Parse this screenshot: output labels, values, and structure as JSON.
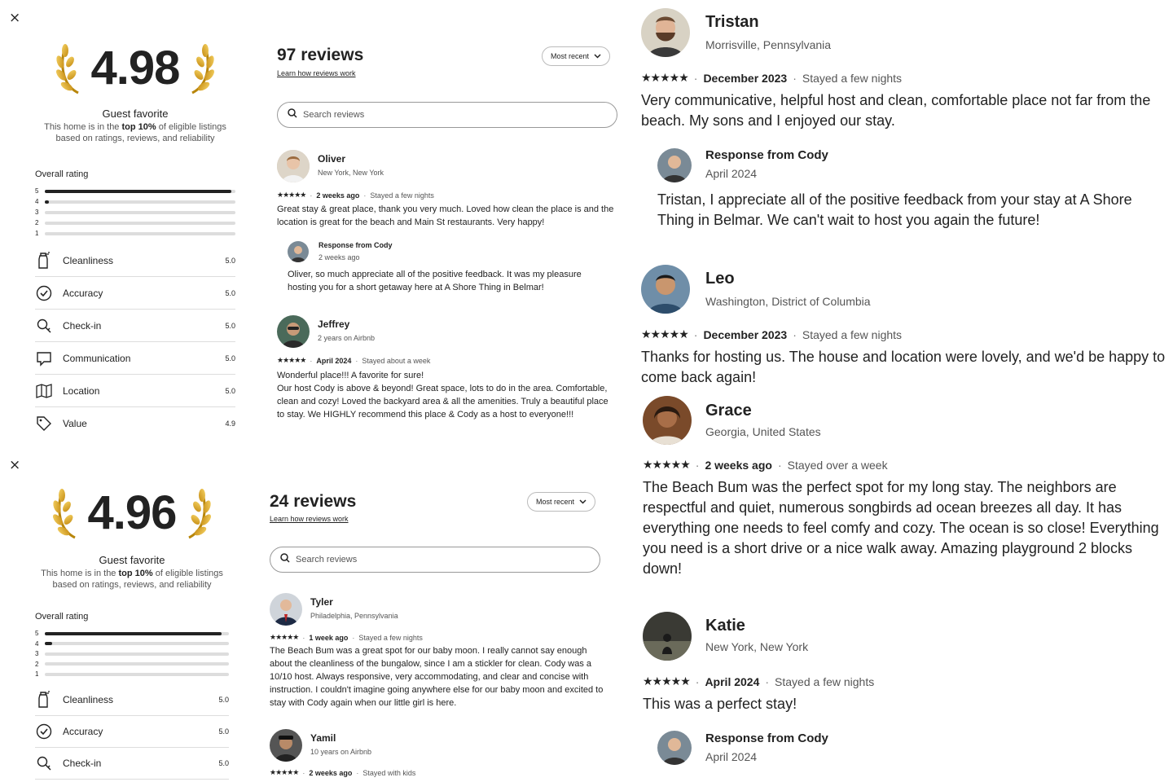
{
  "panels": [
    {
      "close_icon": "×",
      "rating": "4.98",
      "guest_favorite": "Guest favorite",
      "desc_pre": "This home is in the ",
      "desc_bold": "top 10%",
      "desc_post": " of eligible listings based on ratings, reviews, and reliability",
      "overall_label": "Overall rating",
      "histogram": [
        {
          "star": "5",
          "fraction": 0.98
        },
        {
          "star": "4",
          "fraction": 0.02
        },
        {
          "star": "3",
          "fraction": 0
        },
        {
          "star": "2",
          "fraction": 0
        },
        {
          "star": "1",
          "fraction": 0
        }
      ],
      "categories": [
        {
          "label": "Cleanliness",
          "score": "5.0",
          "icon": "spray-bottle-icon"
        },
        {
          "label": "Accuracy",
          "score": "5.0",
          "icon": "check-circle-icon"
        },
        {
          "label": "Check-in",
          "score": "5.0",
          "icon": "key-icon"
        },
        {
          "label": "Communication",
          "score": "5.0",
          "icon": "message-icon"
        },
        {
          "label": "Location",
          "score": "5.0",
          "icon": "map-icon"
        },
        {
          "label": "Value",
          "score": "4.9",
          "icon": "tag-icon"
        }
      ],
      "reviews_title": "97 reviews",
      "learn_link": "Learn how reviews work",
      "sort_label": "Most recent",
      "search_placeholder": "Search reviews",
      "reviews": [
        {
          "name": "Oliver",
          "location": "New York, New York",
          "stars": "★★★★★",
          "date": "2 weeks ago",
          "stay": "Stayed a few nights",
          "text": "Great stay & great place, thank you very much. Loved how clean the place is and the location is great for the beach and Main St restaurants. Very happy!",
          "response": {
            "title": "Response from Cody",
            "date": "2 weeks ago",
            "text": "Oliver, so much appreciate all of the positive feedback. It was my pleasure hosting you for a short getaway here at A Shore Thing in Belmar!"
          }
        },
        {
          "name": "Jeffrey",
          "location": "2 years on Airbnb",
          "stars": "★★★★★",
          "date": "April 2024",
          "stay": "Stayed about a week",
          "text": "Wonderful place!!! A favorite for sure!\nOur host Cody is above & beyond! Great space, lots to do in the area. Comfortable, clean and cozy! Loved the backyard area & all the amenities. Truly a beautiful place to stay. We HIGHLY recommend this place & Cody as a host to everyone!!!"
        }
      ]
    },
    {
      "close_icon": "×",
      "rating": "4.96",
      "guest_favorite": "Guest favorite",
      "desc_pre": "This home is in the ",
      "desc_bold": "top 10%",
      "desc_post": " of eligible listings based on ratings, reviews, and reliability",
      "overall_label": "Overall rating",
      "histogram": [
        {
          "star": "5",
          "fraction": 0.96
        },
        {
          "star": "4",
          "fraction": 0.04
        },
        {
          "star": "3",
          "fraction": 0
        },
        {
          "star": "2",
          "fraction": 0
        },
        {
          "star": "1",
          "fraction": 0
        }
      ],
      "categories": [
        {
          "label": "Cleanliness",
          "score": "5.0",
          "icon": "spray-bottle-icon"
        },
        {
          "label": "Accuracy",
          "score": "5.0",
          "icon": "check-circle-icon"
        },
        {
          "label": "Check-in",
          "score": "5.0",
          "icon": "key-icon"
        }
      ],
      "reviews_title": "24 reviews",
      "learn_link": "Learn how reviews work",
      "sort_label": "Most recent",
      "search_placeholder": "Search reviews",
      "reviews": [
        {
          "name": "Tyler",
          "location": "Philadelphia, Pennsylvania",
          "stars": "★★★★★",
          "date": "1 week ago",
          "stay": "Stayed a few nights",
          "text": "The Beach Bum was a great spot for our baby moon. I really cannot say enough about the cleanliness of the bungalow, since I am a stickler for clean. Cody was a 10/10 host. Always responsive, very accommodating, and clear and concise with instruction. I couldn't imagine going anywhere else for our baby moon and excited to stay with Cody again when our little girl is here."
        },
        {
          "name": "Yamil",
          "location": "10 years on Airbnb",
          "stars": "★★★★★",
          "date": "2 weeks ago",
          "stay": "Stayed with kids"
        }
      ]
    }
  ],
  "large_reviews": [
    {
      "name": "Tristan",
      "location": "Morrisville, Pennsylvania",
      "stars": "★★★★★",
      "date": "December 2023",
      "stay": "Stayed a few nights",
      "text": "Very communicative, helpful host and clean, comfortable place not far from the beach. My sons and I enjoyed our stay.",
      "response": {
        "title": "Response from Cody",
        "date": "April 2024",
        "text": "Tristan, I appreciate all of the positive feedback from your stay at A Shore Thing in Belmar. We can't wait to host you again the future!"
      }
    },
    {
      "name": "Leo",
      "location": "Washington, District of Columbia",
      "stars": "★★★★★",
      "date": "December 2023",
      "stay": "Stayed a few nights",
      "text": "Thanks for hosting us. The house and location were lovely, and we'd be happy to come back again!"
    },
    {
      "name": "Grace",
      "location": "Georgia, United States",
      "stars": "★★★★★",
      "date": "2 weeks ago",
      "stay": "Stayed over a week",
      "text": "The Beach Bum was the perfect spot for my long stay. The neighbors are respectful and quiet, numerous songbirds ad ocean breezes all day. It has everything one needs to feel comfy and cozy. The ocean is so close! Everything you need is a short drive or a nice walk away. Amazing playground 2 blocks down!"
    },
    {
      "name": "Katie",
      "location": "New York, New York",
      "stars": "★★★★★",
      "date": "April 2024",
      "stay": "Stayed a few nights",
      "text": "This was a perfect stay!",
      "response": {
        "title": "Response from Cody",
        "date": "April 2024"
      }
    }
  ],
  "colors": {
    "text": "#222222",
    "muted": "#555555",
    "divider": "#dddddd",
    "laurel_gold": "#d9a520"
  }
}
